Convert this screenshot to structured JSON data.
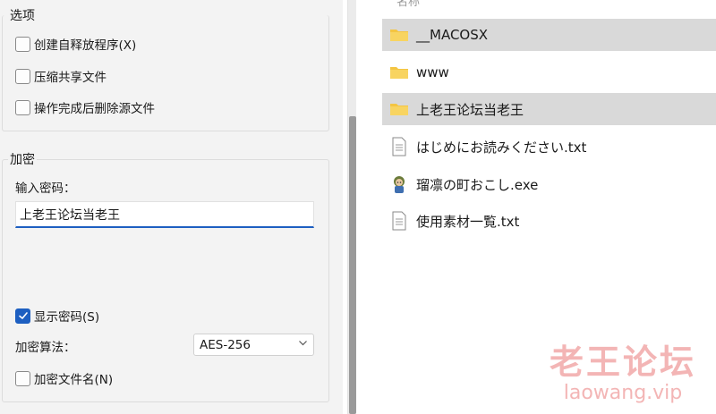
{
  "options": {
    "title": "选项",
    "items": [
      {
        "label": "创建自释放程序(X)",
        "checked": false
      },
      {
        "label": "压缩共享文件",
        "checked": false
      },
      {
        "label": "操作完成后删除源文件",
        "checked": false
      }
    ]
  },
  "encryption": {
    "title": "加密",
    "password_label": "输入密码：",
    "password_value": "上老王论坛当老王",
    "show_password": {
      "label": "显示密码(S)",
      "checked": true
    },
    "algorithm_label": "加密算法：",
    "algorithm_value": "AES-256",
    "encrypt_filenames": {
      "label": "加密文件名(N)",
      "checked": false
    }
  },
  "file_list": {
    "column_header": "名称",
    "items": [
      {
        "name": "__MACOSX",
        "icon": "folder-icon",
        "selected": true
      },
      {
        "name": "www",
        "icon": "folder-icon",
        "selected": false
      },
      {
        "name": "上老王论坛当老王",
        "icon": "folder-icon",
        "selected": true
      },
      {
        "name": "はじめにお読みください.txt",
        "icon": "text-file-icon",
        "selected": false
      },
      {
        "name": "瑠凛の町おこし.exe",
        "icon": "app-exe-icon",
        "selected": false
      },
      {
        "name": "使用素材一覧.txt",
        "icon": "text-file-icon",
        "selected": false
      }
    ]
  },
  "watermark": {
    "title": "老王论坛",
    "url": "laowang.vip"
  },
  "colors": {
    "accent": "#1d5fc1",
    "folder": "#f4c542",
    "selection": "#d9d9d9",
    "watermark": "#f3b5b5"
  }
}
